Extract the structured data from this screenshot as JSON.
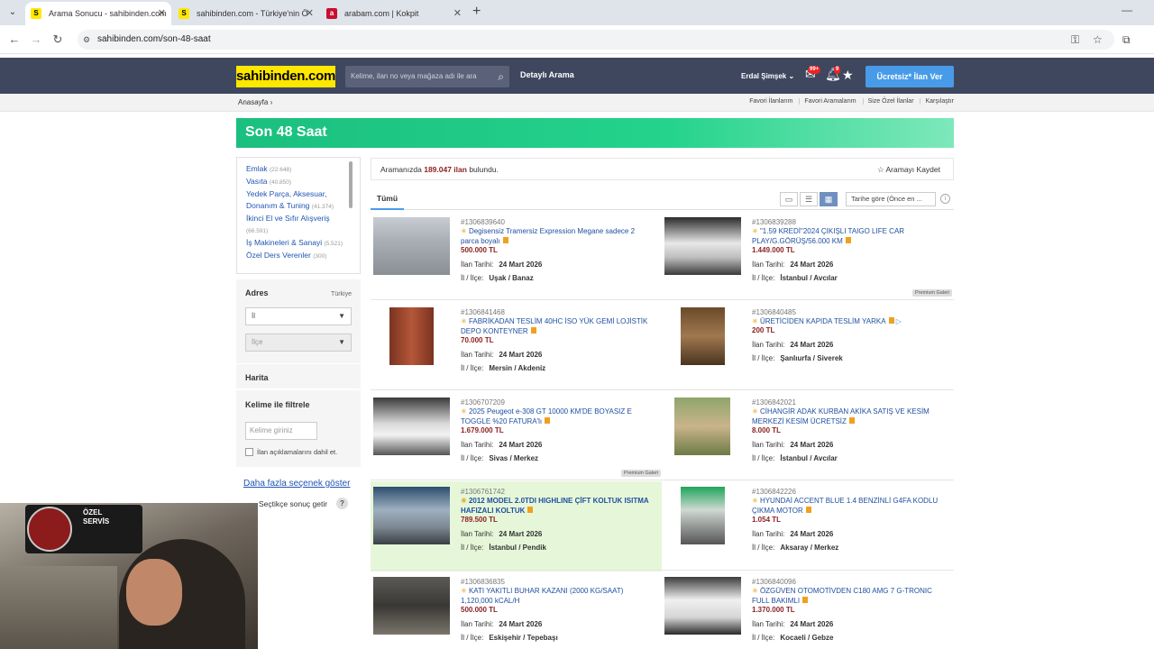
{
  "browser": {
    "tabs": [
      {
        "title": "Arama Sonucu - sahibinden.com",
        "fav": "S"
      },
      {
        "title": "sahibinden.com - Türkiye'nin Ö",
        "fav": "S"
      },
      {
        "title": "arabam.com | Kokpit",
        "fav": "a"
      }
    ],
    "url": "sahibinden.com/son-48-saat"
  },
  "header": {
    "logo": "sahibinden.com",
    "search_placeholder": "Kelime, ilan no veya mağaza adı ile ara",
    "detailed_search": "Detaylı Arama",
    "username": "Erdal Şimşek",
    "messages_badge": "99+",
    "notifications_badge": "9",
    "post_button": "Ücretsiz* İlan Ver"
  },
  "subbar": {
    "breadcrumb": "Anasayfa",
    "links": [
      "Favori İlanlarım",
      "Favori Aramalarım",
      "Size Özel İlanlar",
      "Karşılaştır"
    ]
  },
  "banner": {
    "title": "Son 48 Saat"
  },
  "categories": [
    {
      "name": "Emlak",
      "count": "(22.648)"
    },
    {
      "name": "Vasıta",
      "count": "(40.850)"
    },
    {
      "name": "Yedek Parça, Aksesuar, Donanım & Tuning",
      "count": "(41.374)"
    },
    {
      "name": "İkinci El ve Sıfır Alışveriş",
      "count": "(66.591)"
    },
    {
      "name": "İş Makineleri & Sanayi",
      "count": "(5.521)"
    },
    {
      "name": "Özel Ders Verenler",
      "count": "(300)"
    }
  ],
  "filters": {
    "address_title": "Adres",
    "address_country": "Türkiye",
    "il_placeholder": "İl",
    "ilce_placeholder": "İlçe",
    "map_title": "Harita",
    "keyword_title": "Kelime ile filtrele",
    "keyword_placeholder": "Kelime giriniz",
    "include_desc": "İlan açıklamalarını dahil et.",
    "more_options": "Daha fazla seçenek göster",
    "auto_results": "Seçtikçe sonuç getir"
  },
  "results": {
    "summary_prefix": "Aramanızda",
    "summary_count": "189.047 ilan",
    "summary_suffix": "bulundu.",
    "save_search": "Aramayı Kaydet",
    "tab_all": "Tümü",
    "sort": "Tarihe göre (Önce en ...",
    "date_label": "İlan Tarihi:",
    "loc_label": "İl / İlçe:",
    "premium_label": "Premium Galeri"
  },
  "listings": [
    {
      "id": "#1306839640",
      "title": "Degisensiz Tramersiz Expression Megane sadece 2 parca boyalı",
      "price": "500.000 TL",
      "date": "24 Mart 2026",
      "location": "Uşak / Banaz"
    },
    {
      "id": "#1306839288",
      "title": "\"1.59 KREDİ\"2024 ÇIKIŞLI TAIGO LIFE CAR PLAY/G.GÖRÜŞ/56.000 KM",
      "price": "1.449.000 TL",
      "date": "24 Mart 2026",
      "location": "İstanbul / Avcılar"
    },
    {
      "id": "#1306841468",
      "title": "FABRİKADAN TESLİM 40HC İSO YÜK GEMİ LOJİSTİK DEPO KONTEYNER",
      "price": "70.000 TL",
      "date": "24 Mart 2026",
      "location": "Mersin / Akdeniz"
    },
    {
      "id": "#1306840485",
      "title": "ÜRETİCİDEN KAPIDA TESLİM YARKA",
      "price": "200 TL",
      "date": "24 Mart 2026",
      "location": "Şanlıurfa / Siverek"
    },
    {
      "id": "#1306707209",
      "title": "2025 Peugeot e-308 GT 10000 KM'DE BOYASIZ E TOGGLE %20 FATURA'lı",
      "price": "1.679.000 TL",
      "date": "24 Mart 2026",
      "location": "Sivas / Merkez"
    },
    {
      "id": "#1306842021",
      "title": "CİHANGİR ADAK KURBAN AKİKA SATIŞ VE KESİM MERKEZİ KESİM ÜCRETSİZ",
      "price": "8.000 TL",
      "date": "24 Mart 2026",
      "location": "İstanbul / Avcılar"
    },
    {
      "id": "#1306761742",
      "title": "2012 MODEL 2.0TDI HIGHLINE ÇİFT KOLTUK ISITMA HAFIZALI KOLTUK",
      "price": "789.500 TL",
      "date": "24 Mart 2026",
      "location": "İstanbul / Pendik"
    },
    {
      "id": "#1306842226",
      "title": "HYUNDAİ ACCENT BLUE 1.4 BENZİNLİ G4FA KODLU ÇIKMA MOTOR",
      "price": "1.054 TL",
      "date": "24 Mart 2026",
      "location": "Aksaray / Merkez"
    },
    {
      "id": "#1306836835",
      "title": "KATI YAKITLI BUHAR KAZANI (2000 KG/SAAT) 1,120,000 kCAL/H",
      "price": "500.000 TL",
      "date": "24 Mart 2026",
      "location": "Eskişehir / Tepebaşı"
    },
    {
      "id": "#1306840096",
      "title": "ÖZGÜVEN OTOMOTİVDEN C180 AMG 7 G-TRONIC FULL BAKIMLI",
      "price": "1.370.000 TL",
      "date": "24 Mart 2026",
      "location": "Kocaeli / Gebze"
    }
  ],
  "webcam": {
    "sign_line1": "ÖZEL",
    "sign_line2": "SERVİS"
  },
  "colors": {
    "header_bg": "#3f475f",
    "logo_bg": "#ffe800",
    "banner_green": "#24d38c",
    "link_blue": "#1f55b3",
    "price_red": "#8b1f1f",
    "highlight_green": "#e6f7d9",
    "button_blue": "#489be8"
  }
}
